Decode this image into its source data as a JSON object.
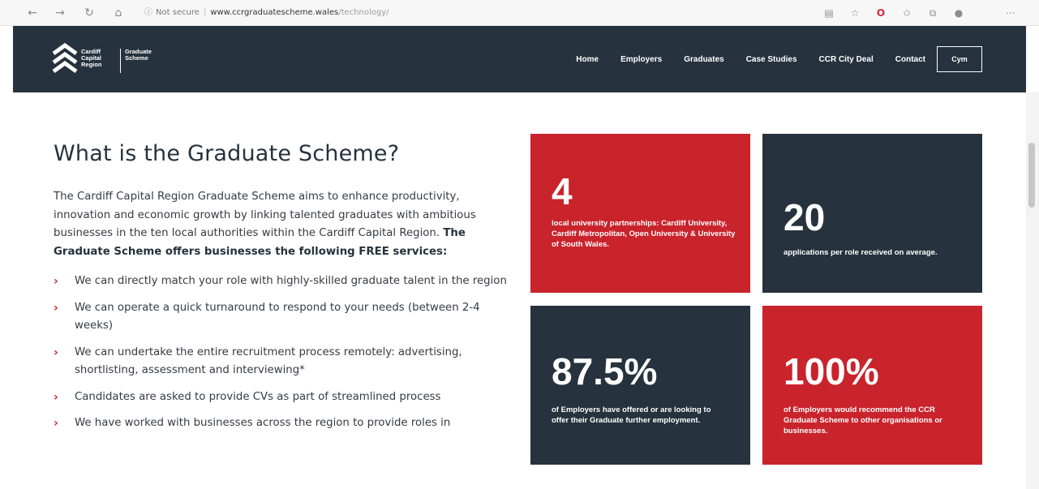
{
  "browser": {
    "back_icon": "arrow-left-icon",
    "forward_icon": "arrow-right-icon",
    "reload_icon": "reload-icon",
    "home_icon": "home-icon",
    "security_label": "Not secure",
    "url_host": "www.ccrgraduatescheme.wales",
    "url_path": "/technology/",
    "extension_icons": [
      "reading-view-icon",
      "favorite-star-icon",
      "opera-icon",
      "favorites-bar-icon",
      "collections-icon",
      "profile-icon",
      "more-menu-icon"
    ]
  },
  "header": {
    "logo": {
      "line1": "Cardiff",
      "line2": "Capital",
      "line3": "Region",
      "scheme1": "Graduate",
      "scheme2": "Scheme"
    },
    "nav": [
      {
        "label": "Home"
      },
      {
        "label": "Employers"
      },
      {
        "label": "Graduates"
      },
      {
        "label": "Case Studies"
      },
      {
        "label": "CCR City Deal"
      },
      {
        "label": "Contact"
      }
    ],
    "language_button": "Cym"
  },
  "main": {
    "title": "What is the Graduate Scheme?",
    "intro_text": "The Cardiff Capital Region Graduate Scheme aims to enhance productivity, innovation and economic growth by linking talented graduates with ambitious businesses in the ten local authorities within the Cardiff Capital Region. ",
    "intro_bold": "The Graduate Scheme offers businesses the following FREE services:",
    "benefits": [
      "We can directly match your role with highly-skilled graduate talent in the region",
      "We can operate a quick turnaround to respond to your needs (between 2-4 weeks)",
      "We can undertake the entire recruitment process remotely: advertising, shortlisting, assessment and interviewing*",
      "Candidates are asked to provide CVs as part of streamlined process",
      "We have worked with businesses across the region to provide roles in"
    ],
    "bullet_glyph": "›"
  },
  "stats": [
    {
      "value": "4",
      "text": "local university partnerships: Cardiff University, Cardiff Metropolitan, Open University & University of South Wales."
    },
    {
      "value": "20",
      "text": "applications per role received on average."
    },
    {
      "value": "87.5%",
      "text": "of Employers have offered or are looking to offer their Graduate further employment."
    },
    {
      "value": "100%",
      "text": "of Employers would recommend the CCR Graduate Scheme to other organisations or businesses."
    }
  ],
  "colors": {
    "navy": "#26323d",
    "red": "#c9232c",
    "white": "#ffffff"
  }
}
